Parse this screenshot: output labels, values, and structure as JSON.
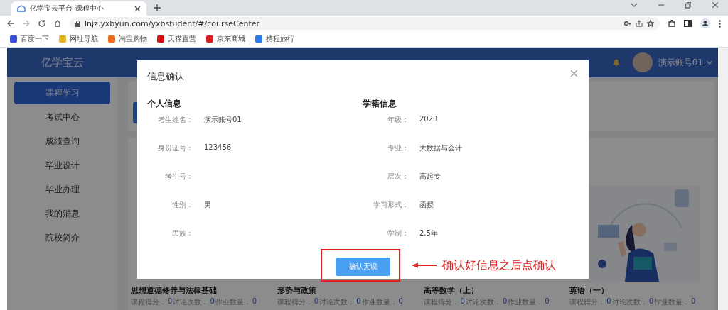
{
  "browser": {
    "tab_title": "亿学宝云平台-课程中心",
    "url": "lnjz.yxbyun.com/yxbstudent/#/courseCenter",
    "bookmarks": [
      {
        "label": "百度一下",
        "color": "#3a4fd8"
      },
      {
        "label": "网址导航",
        "color": "#e0b020"
      },
      {
        "label": "淘宝购物",
        "color": "#f07020"
      },
      {
        "label": "天猫直营",
        "color": "#d01010"
      },
      {
        "label": "京东商城",
        "color": "#d82020"
      },
      {
        "label": "携程旅行",
        "color": "#2a7ae8"
      }
    ]
  },
  "header": {
    "logo": "亿学宝云",
    "user": "演示账号01"
  },
  "sidebar": {
    "items": [
      {
        "label": "课程学习",
        "selected": true
      },
      {
        "label": "考试中心",
        "selected": false
      },
      {
        "label": "成绩查询",
        "selected": false
      },
      {
        "label": "毕业设计",
        "selected": false
      },
      {
        "label": "毕业办理",
        "selected": false
      },
      {
        "label": "我的消息",
        "selected": false
      },
      {
        "label": "院校简介",
        "selected": false
      }
    ]
  },
  "courses": [
    {
      "title": "思想道德修养与法律基础",
      "stats": [
        {
          "label": "课程得分：",
          "value": "0"
        },
        {
          "label": "讨论次数：",
          "value": "0"
        },
        {
          "label": "作业数量：",
          "value": "0"
        }
      ]
    },
    {
      "title": "形势与政策",
      "stats": [
        {
          "label": "课程得分：",
          "value": "0"
        },
        {
          "label": "讨论次数：",
          "value": "0"
        },
        {
          "label": "作业数量：",
          "value": "0"
        }
      ]
    },
    {
      "title": "高等数学（上）",
      "stats": [
        {
          "label": "课程得分：",
          "value": "0"
        },
        {
          "label": "讨论次数：",
          "value": "0"
        },
        {
          "label": "作业数量：",
          "value": "0"
        }
      ]
    },
    {
      "title": "英语（一）",
      "kind": "picture",
      "stats": [
        {
          "label": "课程得分：",
          "value": "0"
        },
        {
          "label": "讨论次数：",
          "value": "0"
        },
        {
          "label": "作业数量：",
          "value": "0"
        }
      ]
    }
  ],
  "dialog": {
    "title": "信息确认",
    "sections": [
      {
        "title": "个人信息",
        "rows": [
          {
            "label": "考生姓名：",
            "value": "演示账号01"
          },
          {
            "label": "身份证号：",
            "value": "123456"
          },
          {
            "label": "考生号："
          },
          {
            "label": "性别：",
            "value": "男"
          },
          {
            "label": "民族："
          }
        ]
      },
      {
        "title": "学籍信息",
        "rows": [
          {
            "label": "年级：",
            "value": "2023"
          },
          {
            "label": "专业：",
            "value": "大数据与会计"
          },
          {
            "label": "层次：",
            "value": "高起专"
          },
          {
            "label": "学习形式：",
            "value": "函授"
          },
          {
            "label": "学制：",
            "value": "2.5年"
          }
        ]
      }
    ],
    "confirm_button": "确认无误"
  },
  "annotation": {
    "text": "确认好信息之后点确认"
  }
}
